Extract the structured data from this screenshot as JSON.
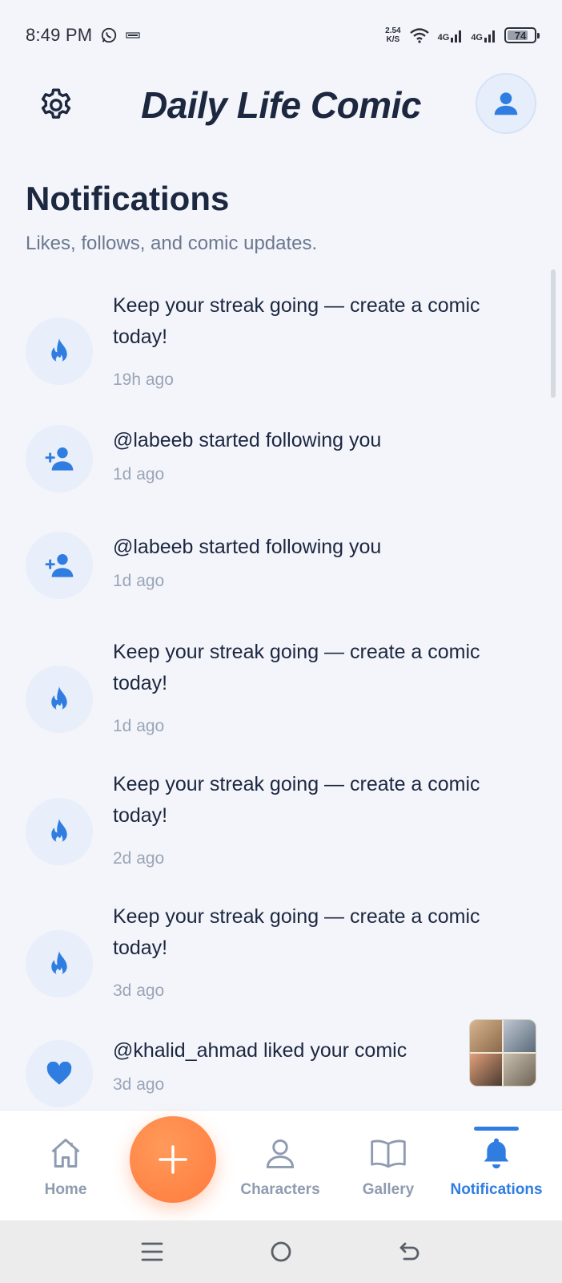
{
  "status_bar": {
    "time": "8:49 PM",
    "net_speed_value": "2.54",
    "net_speed_unit": "K/S",
    "network_1": "4G",
    "network_2": "4G",
    "battery": "74",
    "battery_level_percent": 74
  },
  "header": {
    "app_title": "Daily Life Comic",
    "settings_icon": "gear-icon",
    "profile_icon": "user-icon"
  },
  "page": {
    "title": "Notifications",
    "subtitle": "Likes, follows, and comic updates."
  },
  "notifications": [
    {
      "icon": "flame-icon",
      "text": "Keep your streak going — create a comic today!",
      "time": "19h ago"
    },
    {
      "icon": "person-add-icon",
      "text": "@labeeb started following you",
      "time": "1d ago"
    },
    {
      "icon": "person-add-icon",
      "text": "@labeeb started following you",
      "time": "1d ago"
    },
    {
      "icon": "flame-icon",
      "text": "Keep your streak going — create a comic today!",
      "time": "1d ago"
    },
    {
      "icon": "flame-icon",
      "text": "Keep your streak going — create a comic today!",
      "time": "2d ago"
    },
    {
      "icon": "flame-icon",
      "text": "Keep your streak going — create a comic today!",
      "time": "3d ago"
    },
    {
      "icon": "heart-icon",
      "text": "@khalid_ahmad liked your comic",
      "time": "3d ago",
      "has_thumbnail": true
    }
  ],
  "bottom_nav": {
    "home": "Home",
    "characters": "Characters",
    "gallery": "Gallery",
    "notifications": "Notifications",
    "active": "notifications",
    "fab_icon": "plus-icon"
  },
  "colors": {
    "accent": "#2f7de1",
    "fab": "#ff7a3c",
    "background": "#f3f5fa",
    "text_primary": "#1c2740",
    "text_muted": "#9aa5b8"
  }
}
